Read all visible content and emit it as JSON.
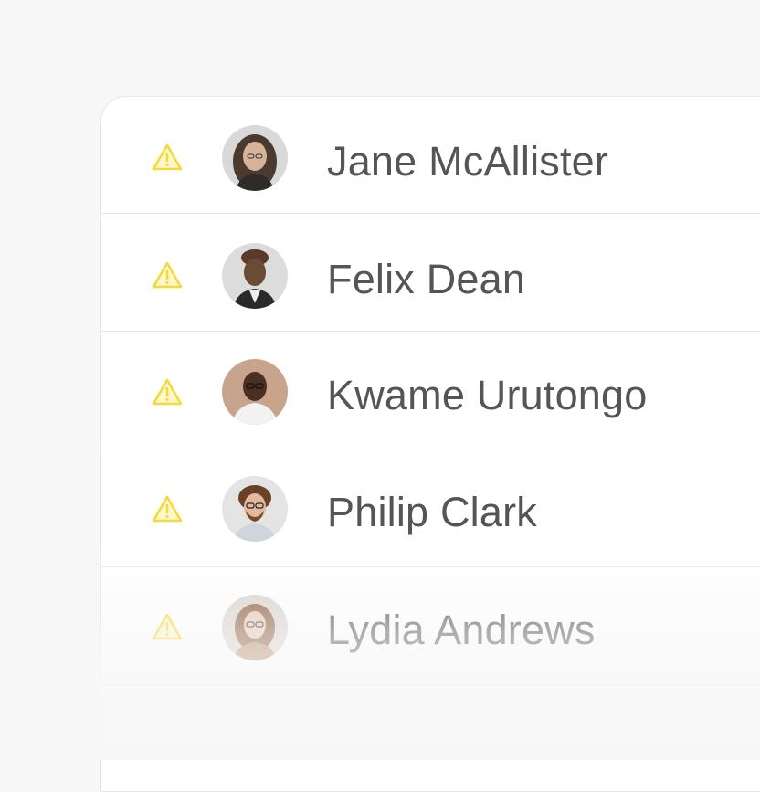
{
  "colors": {
    "warning": "#f5d83a",
    "name_text": "#555555",
    "background": "#f7f7f7"
  },
  "list": {
    "items": [
      {
        "name": "Jane McAllister",
        "status_icon": "warning-icon",
        "avatar": "avatar-jane"
      },
      {
        "name": "Felix Dean",
        "status_icon": "warning-icon",
        "avatar": "avatar-felix"
      },
      {
        "name": "Kwame Urutongo",
        "status_icon": "warning-icon",
        "avatar": "avatar-kwame"
      },
      {
        "name": "Philip Clark",
        "status_icon": "warning-icon",
        "avatar": "avatar-philip"
      },
      {
        "name": "Lydia Andrews",
        "status_icon": "warning-icon",
        "avatar": "avatar-lydia"
      }
    ]
  }
}
